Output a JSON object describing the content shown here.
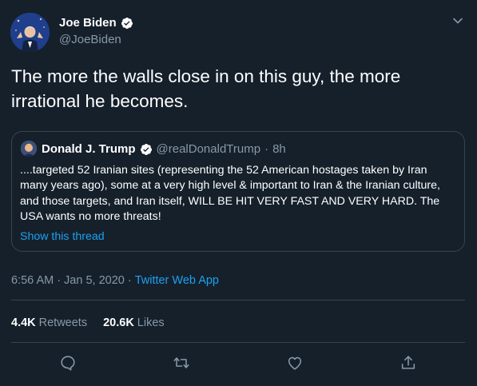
{
  "author": {
    "name": "Joe Biden",
    "handle": "@JoeBiden"
  },
  "tweet": {
    "text": "The more the walls close in on this guy, the more irrational he becomes."
  },
  "quoted": {
    "name": "Donald J. Trump",
    "handle": "@realDonaldTrump",
    "separator": "·",
    "time": "8h",
    "text": "....targeted 52 Iranian sites (representing the 52 American hostages taken by Iran many years ago), some at a very high level & important to Iran &  the Iranian culture, and those targets, and Iran itself, WILL BE HIT VERY FAST AND VERY HARD. The USA wants no more threats!",
    "show_thread": "Show this thread"
  },
  "meta": {
    "time": "6:56 AM",
    "separator1": "·",
    "date": "Jan 5, 2020",
    "separator2": "·",
    "source": "Twitter Web App"
  },
  "stats": {
    "retweets_count": "4.4K",
    "retweets_label": "Retweets",
    "likes_count": "20.6K",
    "likes_label": "Likes"
  },
  "icons": {
    "verified": "verified-badge-icon",
    "more": "chevron-down-icon",
    "reply": "reply-icon",
    "retweet": "retweet-icon",
    "like": "heart-icon",
    "share": "share-icon"
  },
  "colors": {
    "background": "#15202b",
    "accent": "#1da1f2",
    "muted": "#8899a6",
    "border": "#38444d"
  }
}
